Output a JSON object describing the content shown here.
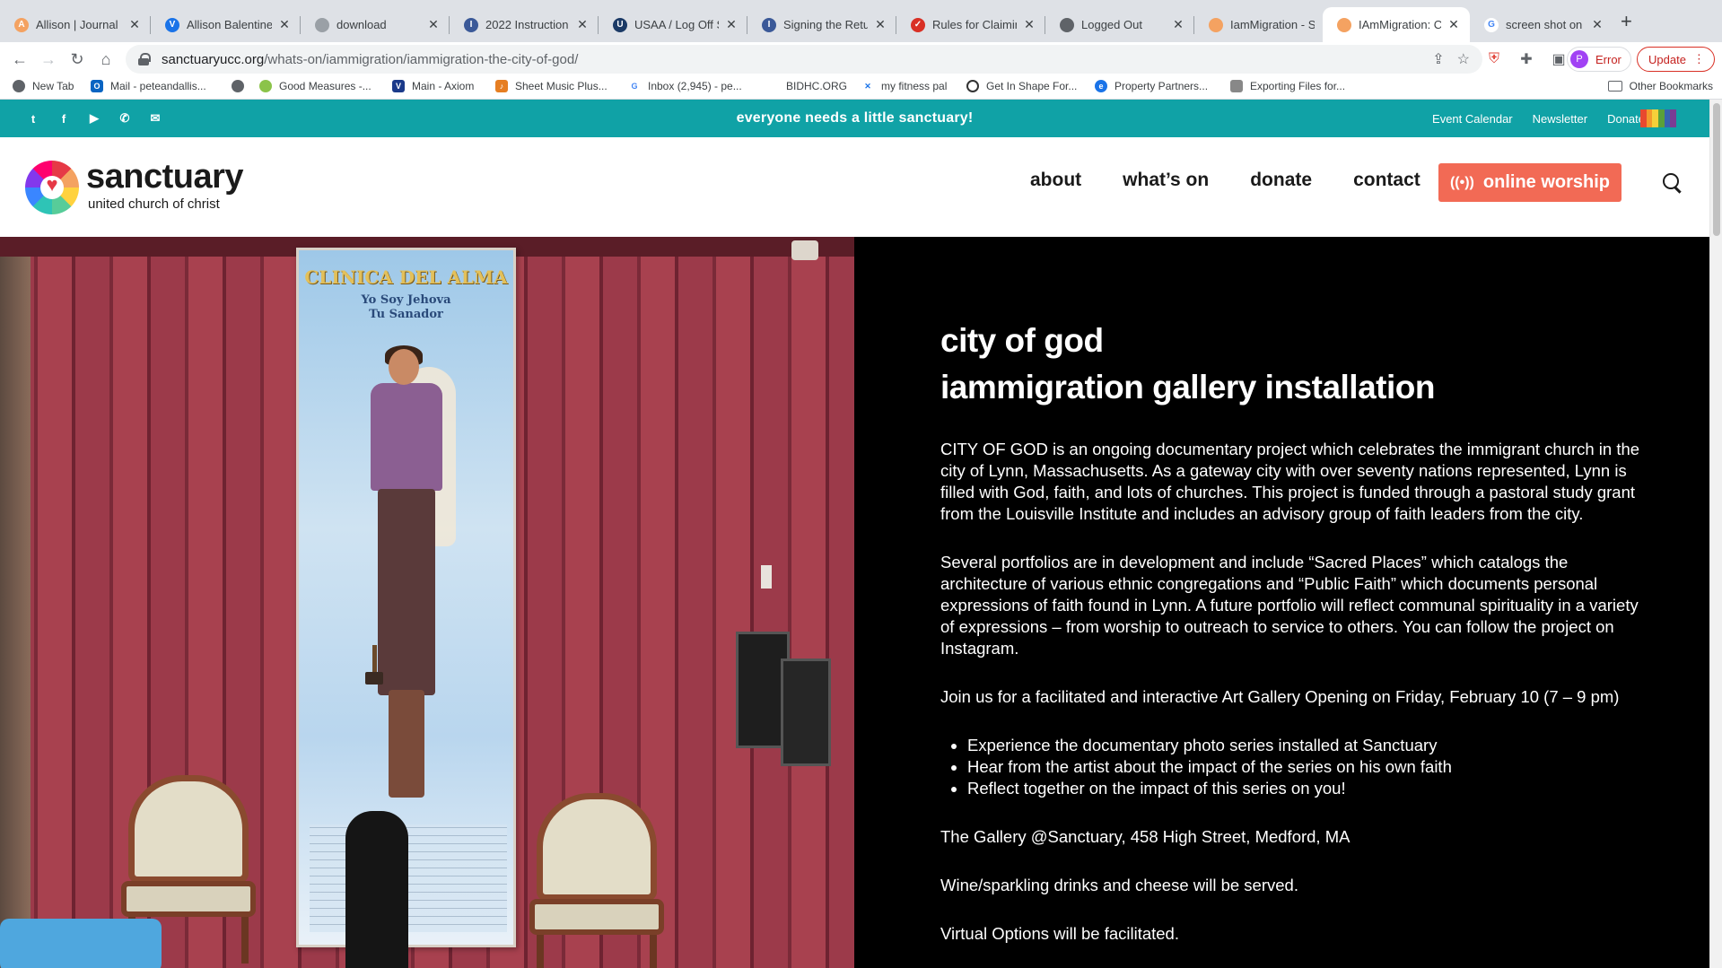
{
  "browser": {
    "tabs": [
      {
        "title": "Allison | Journal",
        "color": "#f4a261",
        "glyph": "A"
      },
      {
        "title": "Allison Balentine",
        "color": "#1a73e8",
        "glyph": "V"
      },
      {
        "title": "download",
        "color": "#9aa0a6",
        "glyph": ""
      },
      {
        "title": "2022 Instruction",
        "color": "#3b5998",
        "glyph": "I"
      },
      {
        "title": "USAA / Log Off S",
        "color": "#1b3a66",
        "glyph": "U"
      },
      {
        "title": "Signing the Retur",
        "color": "#3b5998",
        "glyph": "I"
      },
      {
        "title": "Rules for Claimin",
        "color": "#d93025",
        "glyph": "✓"
      },
      {
        "title": "Logged Out",
        "color": "#5f6368",
        "glyph": ""
      },
      {
        "title": "IamMigration - S",
        "color": "#f4a261",
        "glyph": ""
      },
      {
        "title": "IAmMigration: Ci",
        "color": "#f4a261",
        "glyph": ""
      },
      {
        "title": "screen shot on in",
        "color": "#ffffff",
        "glyph": "G"
      }
    ],
    "new_tab_label": "+",
    "url_host": "sanctuaryucc.org",
    "url_path": "/whats-on/iammigration/iammigration-the-city-of-god/",
    "profile_label": "Error",
    "profile_initial": "P",
    "update_label": "Update",
    "bookmarks": [
      {
        "label": "New Tab",
        "color": "#5f6368"
      },
      {
        "label": "Mail - peteandallis...",
        "color": "#0a64c2"
      },
      {
        "label": "",
        "color": "#5f6368"
      },
      {
        "label": "Good Measures -...",
        "color": "#8bc34a"
      },
      {
        "label": "Main - Axiom",
        "color": "#1b3a8a"
      },
      {
        "label": "Sheet Music Plus...",
        "color": "#e67e22"
      },
      {
        "label": "Inbox (2,945) - pe...",
        "color": "#4285f4"
      },
      {
        "label": "BIDHC.ORG",
        "color": "#ffffff"
      },
      {
        "label": "my fitness pal",
        "color": "#1a73e8"
      },
      {
        "label": "Get In Shape For...",
        "color": "#333333"
      },
      {
        "label": "Property Partners...",
        "color": "#1a73e8"
      },
      {
        "label": "Exporting Files for...",
        "color": "#888888"
      }
    ],
    "other_bookmarks": "Other Bookmarks"
  },
  "site": {
    "tagline": "everyone needs a little sanctuary!",
    "top_links": [
      "Event Calendar",
      "Newsletter",
      "Donate"
    ],
    "logo_word": "sanctuary",
    "logo_sub": "united church of christ",
    "nav": [
      "about",
      "what’s on",
      "donate",
      "contact"
    ],
    "worship_button": "online worship",
    "accent_teal": "#10a2a6",
    "accent_coral": "#f26a55"
  },
  "photo": {
    "poster_title": "CLINICA DEL ALMA",
    "poster_subtitle_1": "Yo Soy Jehova",
    "poster_subtitle_2": "Tu Sanador"
  },
  "article": {
    "title_line1": "city of god",
    "title_line2": "iammigration gallery installation",
    "p1": "CITY OF GOD is an ongoing documentary project which celebrates the immigrant church in the city of Lynn, Massachusetts.  As a gateway city with over seventy nations represented, Lynn is filled with God, faith, and lots of churches.  This project is funded through a pastoral study grant from the Louisville Institute and includes an advisory group of faith leaders from the city.",
    "p2": "Several portfolios are in development and include “Sacred Places” which catalogs the architecture of various ethnic congregations and “Public Faith” which documents personal expressions of faith found in Lynn.   A future portfolio will reflect communal spirituality in a variety of expressions – from worship to outreach to service to others.  You can follow the project on Instagram.",
    "p3": "Join us for a facilitated and interactive Art Gallery Opening on Friday, February 10 (7 – 9 pm)",
    "bullets": [
      "Experience the documentary photo series installed at Sanctuary",
      "Hear from the artist about the impact of the series on his own faith",
      "Reflect together on the impact of this series on you!"
    ],
    "p4": "The Gallery @Sanctuary, 458 High Street, Medford, MA",
    "p5": "Wine/sparkling drinks and cheese will be served.",
    "p6": "Virtual Options will be facilitated."
  }
}
